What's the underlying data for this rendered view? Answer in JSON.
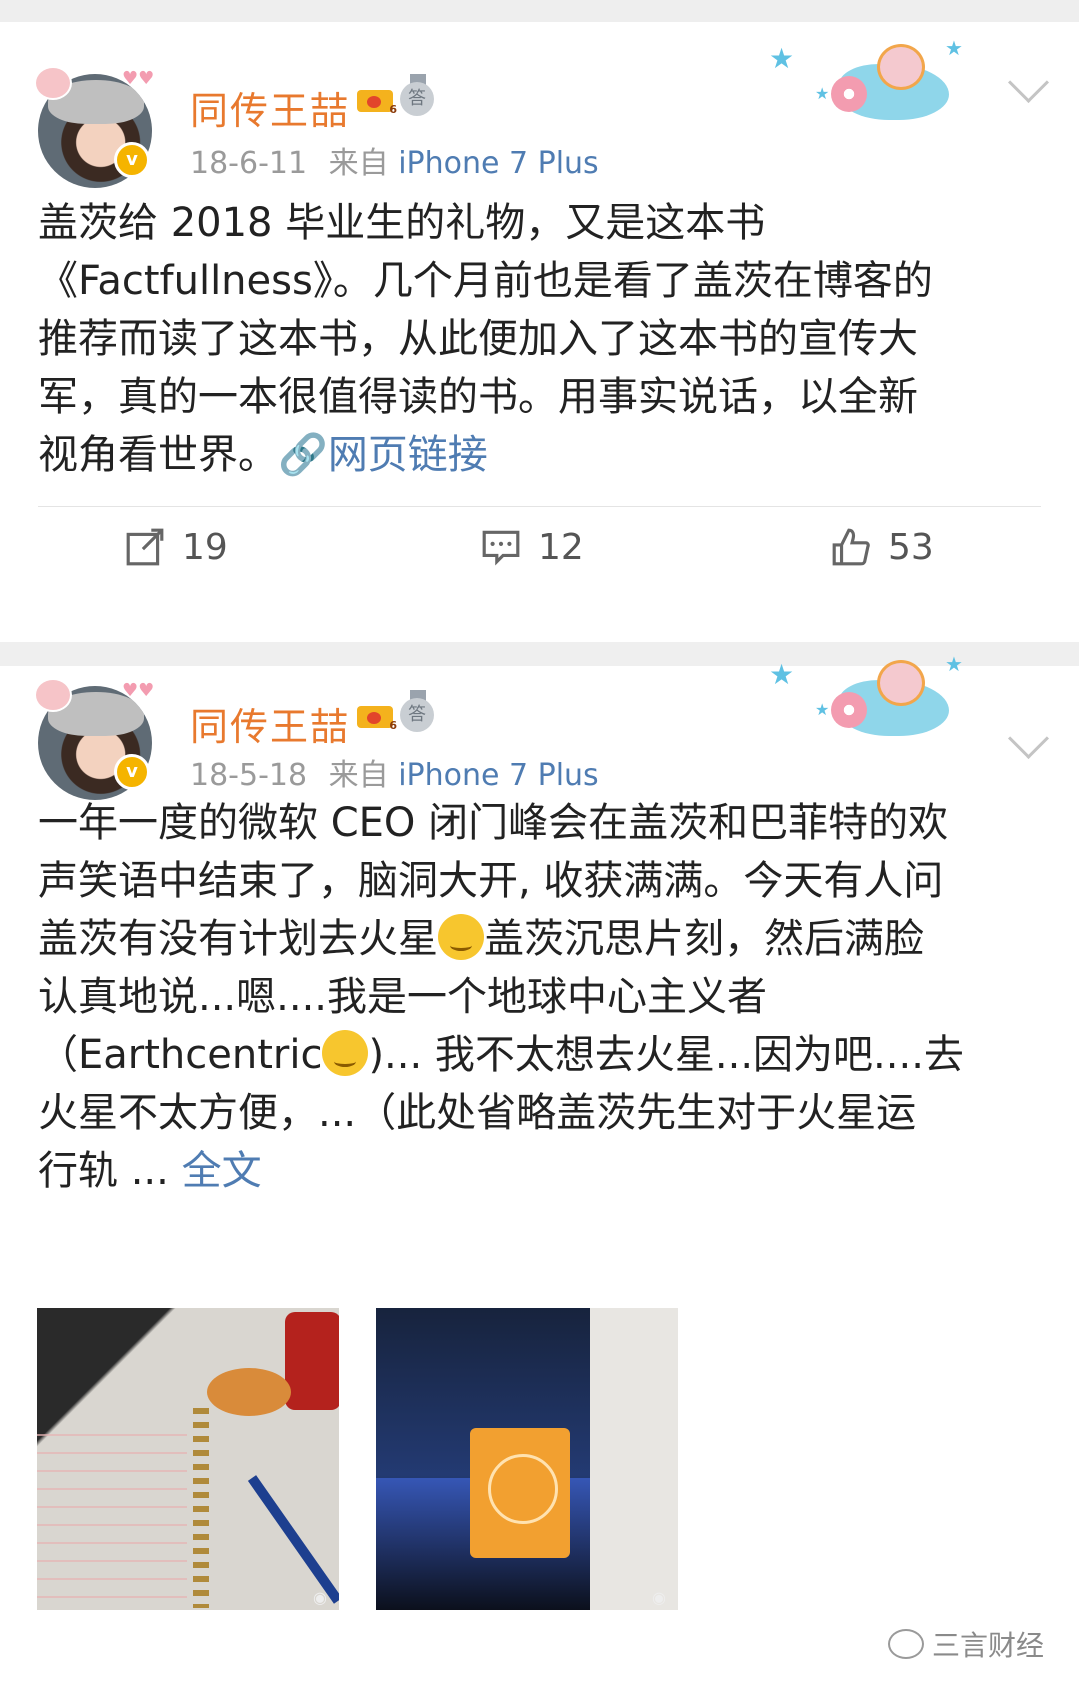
{
  "posts": [
    {
      "username": "同传王喆",
      "crown_level": "6",
      "medal_char": "答",
      "verified_char": "v",
      "date": "18-6-11",
      "from_label": "来自",
      "source": "iPhone 7 Plus",
      "text": "盖茨给 2018 毕业生的礼物，又是这本书\n《Factfullness》。几个月前也是看了盖茨在博客的\n推荐而读了这本书，从此便加入了这本书的宣传大\n军，真的一本很值得读的书。用事实说话，以全新\n视角看世界。",
      "link_label": "网页链接",
      "repost_count": "19",
      "comment_count": "12",
      "like_count": "53"
    },
    {
      "username": "同传王喆",
      "crown_level": "6",
      "medal_char": "答",
      "verified_char": "v",
      "date": "18-5-18",
      "from_label": "来自",
      "source": "iPhone 7 Plus",
      "text_part1": "一年一度的微软 CEO 闭门峰会在盖茨和巴菲特的欢\n声笑语中结束了，脑洞大开, 收获满满。今天有人问\n盖茨有没有计划去火星",
      "text_part2": "盖茨沉思片刻，然后满脸\n认真地说...嗯....我是一个地球中心主义者\n（Earthcentric",
      "text_part3": ")... 我不太想去火星...因为吧....去\n火星不太方便，...（此处省略盖茨先生对于火星运\n行轨 ... ",
      "full_text_label": "全文",
      "image_icons": [
        "notebook-photo",
        "conference-stage-photo"
      ]
    }
  ],
  "watermark": "三言财经",
  "colors": {
    "username": "#e8792e",
    "link": "#4f7cb2",
    "meta": "#9a9a9a"
  }
}
